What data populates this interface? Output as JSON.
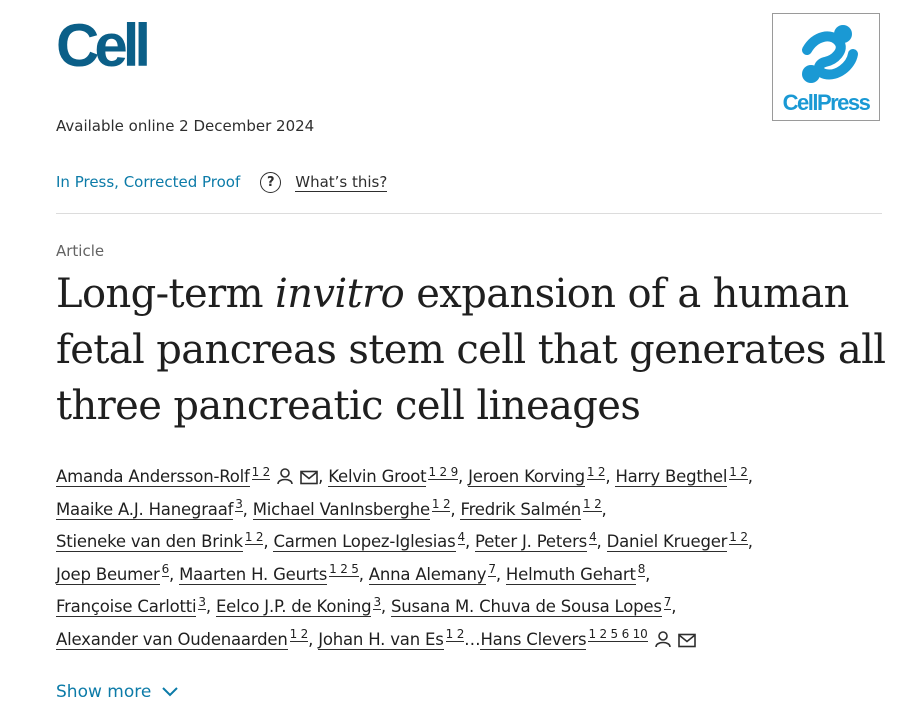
{
  "header": {
    "journal_logo": "Cell",
    "publisher_logo": "CellPress",
    "available_online": "Available online 2 December 2024"
  },
  "status": {
    "label": "In Press, Corrected Proof",
    "help_icon": "?",
    "whats_this": "What’s this?"
  },
  "article": {
    "type": "Article",
    "title_part1": "Long-term ",
    "title_italic": "invitro",
    "title_part2": " expansion of a human fetal pancreas stem cell that generates all three pancreatic cell lineages"
  },
  "authors_lines": [
    [
      {
        "name": "Amanda Andersson-Rolf",
        "aff": "1 2",
        "icons": true,
        "sep": ", "
      },
      {
        "name": "Kelvin Groot",
        "aff": "1 2 9",
        "sep": ", "
      },
      {
        "name": "Jeroen Korving",
        "aff": "1 2",
        "sep": ", "
      },
      {
        "name": "Harry Begthel",
        "aff": "1 2",
        "sep": ","
      }
    ],
    [
      {
        "name": "Maaike A.J. Hanegraaf",
        "aff": "3",
        "sep": ", "
      },
      {
        "name": "Michael VanInsberghe",
        "aff": "1 2",
        "sep": ", "
      },
      {
        "name": "Fredrik Salmén",
        "aff": "1 2",
        "sep": ","
      }
    ],
    [
      {
        "name": "Stieneke van den Brink",
        "aff": "1 2",
        "sep": ", "
      },
      {
        "name": "Carmen Lopez-Iglesias",
        "aff": "4",
        "sep": ", "
      },
      {
        "name": "Peter J. Peters",
        "aff": "4",
        "sep": ", "
      },
      {
        "name": "Daniel Krueger",
        "aff": "1 2",
        "sep": ","
      }
    ],
    [
      {
        "name": "Joep Beumer",
        "aff": "6",
        "sep": ", "
      },
      {
        "name": "Maarten H. Geurts",
        "aff": "1 2 5",
        "sep": ", "
      },
      {
        "name": "Anna Alemany",
        "aff": "7",
        "sep": ", "
      },
      {
        "name": "Helmuth Gehart",
        "aff": "8",
        "sep": ","
      }
    ],
    [
      {
        "name": "Françoise Carlotti",
        "aff": "3",
        "sep": ", "
      },
      {
        "name": "Eelco J.P. de Koning",
        "aff": "3",
        "sep": ", "
      },
      {
        "name": "Susana M. Chuva de Sousa Lopes",
        "aff": "7",
        "sep": ","
      }
    ],
    [
      {
        "name": "Alexander van Oudenaarden",
        "aff": "1 2",
        "sep": ", "
      },
      {
        "name": "Johan H. van Es",
        "aff": "1 2",
        "sep": "…"
      },
      {
        "name": "Hans Clevers",
        "aff": "1 2 5 6 10",
        "icons": true,
        "sep": ""
      }
    ]
  ],
  "show_more": "Show more",
  "icons": {
    "person": "person-icon",
    "mail": "mail-icon",
    "chevron": "chevron-down-icon",
    "help": "help-icon"
  },
  "colors": {
    "journal_blue": "#0b5f88",
    "link_blue": "#0c7ba8",
    "publisher_blue": "#1a99d4"
  }
}
